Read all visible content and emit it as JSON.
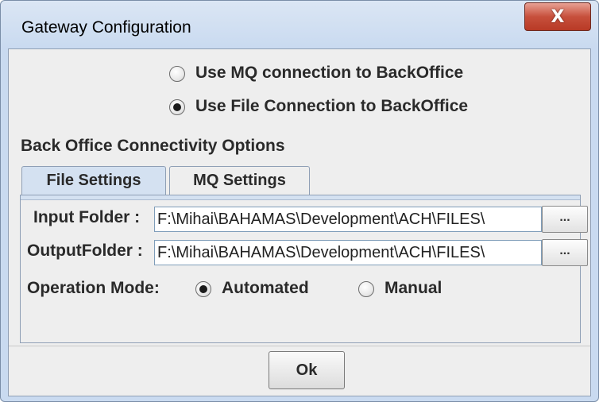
{
  "window": {
    "title": "Gateway Configuration",
    "close_glyph": "X",
    "close_icon": "close-icon"
  },
  "connection": {
    "options": [
      {
        "label": "Use MQ connection to BackOffice",
        "selected": false
      },
      {
        "label": "Use File Connection to BackOffice",
        "selected": true
      }
    ]
  },
  "section_title": "Back Office Connectivity Options",
  "tabs": [
    {
      "label": "File Settings",
      "active": true
    },
    {
      "label": "MQ Settings",
      "active": false
    }
  ],
  "file_settings": {
    "input_folder": {
      "label": "Input Folder :",
      "value": "F:\\Mihai\\BAHAMAS\\Development\\ACH\\FILES\\",
      "browse_label": "..."
    },
    "output_folder": {
      "label": "OutputFolder :",
      "value": "F:\\Mihai\\BAHAMAS\\Development\\ACH\\FILES\\",
      "browse_label": "..."
    },
    "operation_mode": {
      "label": "Operation Mode:",
      "options": [
        {
          "label": "Automated",
          "selected": true
        },
        {
          "label": "Manual",
          "selected": false
        }
      ]
    }
  },
  "ok_label": "Ok",
  "colors": {
    "title_gradient_top": "#dbe6f4",
    "close_button": "#c7503c",
    "active_tab": "#d4e1f1",
    "panel_background": "#eeeeee"
  }
}
